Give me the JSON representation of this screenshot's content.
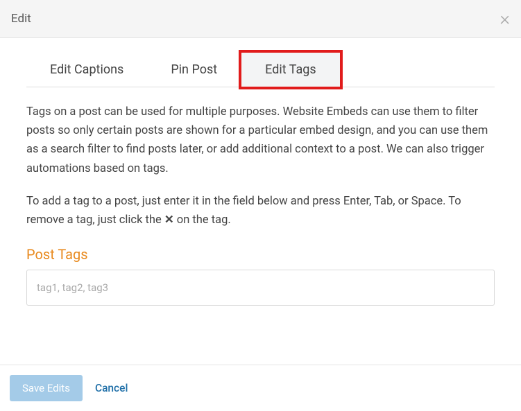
{
  "header": {
    "title": "Edit"
  },
  "tabs": {
    "captions": "Edit Captions",
    "pin": "Pin Post",
    "tags": "Edit Tags"
  },
  "body": {
    "description": "Tags on a post can be used for multiple purposes. Website Embeds can use them to filter posts so only certain posts are shown for a particular embed design, and you can use them as a search filter to find posts later, or add additional context to a post. We can also trigger automations based on tags.",
    "instruction_pre": "To add a tag to a post, just enter it in the field below and press Enter, Tab, or Space. To remove a tag, just click the ",
    "instruction_x": "✕",
    "instruction_post": " on the tag.",
    "section_heading": "Post Tags",
    "tag_input_placeholder": "tag1, tag2, tag3",
    "tag_input_value": ""
  },
  "footer": {
    "save": "Save Edits",
    "cancel": "Cancel"
  }
}
